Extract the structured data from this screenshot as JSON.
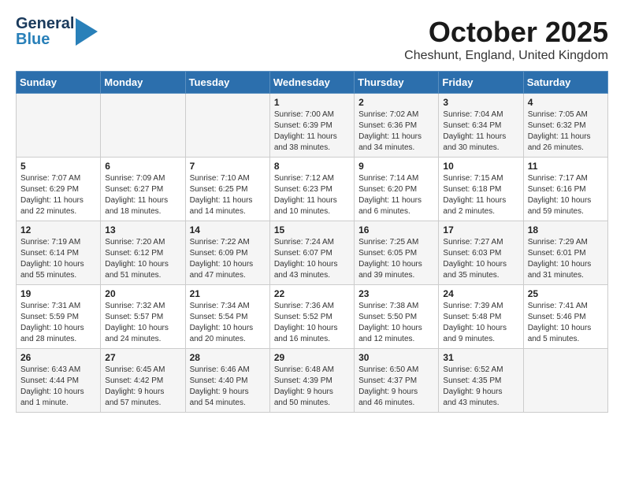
{
  "logo": {
    "line1": "General",
    "line2": "Blue",
    "arrow": "▶"
  },
  "title": "October 2025",
  "location": "Cheshunt, England, United Kingdom",
  "weekdays": [
    "Sunday",
    "Monday",
    "Tuesday",
    "Wednesday",
    "Thursday",
    "Friday",
    "Saturday"
  ],
  "weeks": [
    [
      {
        "day": "",
        "info": ""
      },
      {
        "day": "",
        "info": ""
      },
      {
        "day": "",
        "info": ""
      },
      {
        "day": "1",
        "info": "Sunrise: 7:00 AM\nSunset: 6:39 PM\nDaylight: 11 hours\nand 38 minutes."
      },
      {
        "day": "2",
        "info": "Sunrise: 7:02 AM\nSunset: 6:36 PM\nDaylight: 11 hours\nand 34 minutes."
      },
      {
        "day": "3",
        "info": "Sunrise: 7:04 AM\nSunset: 6:34 PM\nDaylight: 11 hours\nand 30 minutes."
      },
      {
        "day": "4",
        "info": "Sunrise: 7:05 AM\nSunset: 6:32 PM\nDaylight: 11 hours\nand 26 minutes."
      }
    ],
    [
      {
        "day": "5",
        "info": "Sunrise: 7:07 AM\nSunset: 6:29 PM\nDaylight: 11 hours\nand 22 minutes."
      },
      {
        "day": "6",
        "info": "Sunrise: 7:09 AM\nSunset: 6:27 PM\nDaylight: 11 hours\nand 18 minutes."
      },
      {
        "day": "7",
        "info": "Sunrise: 7:10 AM\nSunset: 6:25 PM\nDaylight: 11 hours\nand 14 minutes."
      },
      {
        "day": "8",
        "info": "Sunrise: 7:12 AM\nSunset: 6:23 PM\nDaylight: 11 hours\nand 10 minutes."
      },
      {
        "day": "9",
        "info": "Sunrise: 7:14 AM\nSunset: 6:20 PM\nDaylight: 11 hours\nand 6 minutes."
      },
      {
        "day": "10",
        "info": "Sunrise: 7:15 AM\nSunset: 6:18 PM\nDaylight: 11 hours\nand 2 minutes."
      },
      {
        "day": "11",
        "info": "Sunrise: 7:17 AM\nSunset: 6:16 PM\nDaylight: 10 hours\nand 59 minutes."
      }
    ],
    [
      {
        "day": "12",
        "info": "Sunrise: 7:19 AM\nSunset: 6:14 PM\nDaylight: 10 hours\nand 55 minutes."
      },
      {
        "day": "13",
        "info": "Sunrise: 7:20 AM\nSunset: 6:12 PM\nDaylight: 10 hours\nand 51 minutes."
      },
      {
        "day": "14",
        "info": "Sunrise: 7:22 AM\nSunset: 6:09 PM\nDaylight: 10 hours\nand 47 minutes."
      },
      {
        "day": "15",
        "info": "Sunrise: 7:24 AM\nSunset: 6:07 PM\nDaylight: 10 hours\nand 43 minutes."
      },
      {
        "day": "16",
        "info": "Sunrise: 7:25 AM\nSunset: 6:05 PM\nDaylight: 10 hours\nand 39 minutes."
      },
      {
        "day": "17",
        "info": "Sunrise: 7:27 AM\nSunset: 6:03 PM\nDaylight: 10 hours\nand 35 minutes."
      },
      {
        "day": "18",
        "info": "Sunrise: 7:29 AM\nSunset: 6:01 PM\nDaylight: 10 hours\nand 31 minutes."
      }
    ],
    [
      {
        "day": "19",
        "info": "Sunrise: 7:31 AM\nSunset: 5:59 PM\nDaylight: 10 hours\nand 28 minutes."
      },
      {
        "day": "20",
        "info": "Sunrise: 7:32 AM\nSunset: 5:57 PM\nDaylight: 10 hours\nand 24 minutes."
      },
      {
        "day": "21",
        "info": "Sunrise: 7:34 AM\nSunset: 5:54 PM\nDaylight: 10 hours\nand 20 minutes."
      },
      {
        "day": "22",
        "info": "Sunrise: 7:36 AM\nSunset: 5:52 PM\nDaylight: 10 hours\nand 16 minutes."
      },
      {
        "day": "23",
        "info": "Sunrise: 7:38 AM\nSunset: 5:50 PM\nDaylight: 10 hours\nand 12 minutes."
      },
      {
        "day": "24",
        "info": "Sunrise: 7:39 AM\nSunset: 5:48 PM\nDaylight: 10 hours\nand 9 minutes."
      },
      {
        "day": "25",
        "info": "Sunrise: 7:41 AM\nSunset: 5:46 PM\nDaylight: 10 hours\nand 5 minutes."
      }
    ],
    [
      {
        "day": "26",
        "info": "Sunrise: 6:43 AM\nSunset: 4:44 PM\nDaylight: 10 hours\nand 1 minute."
      },
      {
        "day": "27",
        "info": "Sunrise: 6:45 AM\nSunset: 4:42 PM\nDaylight: 9 hours\nand 57 minutes."
      },
      {
        "day": "28",
        "info": "Sunrise: 6:46 AM\nSunset: 4:40 PM\nDaylight: 9 hours\nand 54 minutes."
      },
      {
        "day": "29",
        "info": "Sunrise: 6:48 AM\nSunset: 4:39 PM\nDaylight: 9 hours\nand 50 minutes."
      },
      {
        "day": "30",
        "info": "Sunrise: 6:50 AM\nSunset: 4:37 PM\nDaylight: 9 hours\nand 46 minutes."
      },
      {
        "day": "31",
        "info": "Sunrise: 6:52 AM\nSunset: 4:35 PM\nDaylight: 9 hours\nand 43 minutes."
      },
      {
        "day": "",
        "info": ""
      }
    ]
  ]
}
